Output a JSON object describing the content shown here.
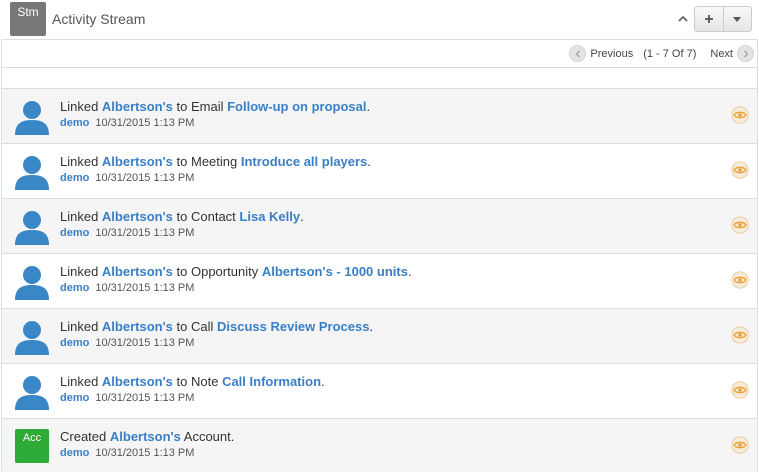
{
  "header": {
    "badge": "Stm",
    "title": "Activity Stream"
  },
  "pagination": {
    "previous": "Previous",
    "range": "(1 - 7 Of 7)",
    "next": "Next"
  },
  "colors": {
    "link": "#3a7fc6",
    "account_badge": "#2eaa37",
    "module_badge": "#777777",
    "eye_icon": "#e8a33d"
  },
  "rows": [
    {
      "prefix": "Linked ",
      "entity": "Albertson's",
      "middle": " to Email ",
      "target": "Follow-up on proposal",
      "suffix": ".",
      "user": "demo",
      "time": "10/31/2015 1:13 PM",
      "icon": "user-avatar-icon"
    },
    {
      "prefix": "Linked ",
      "entity": "Albertson's",
      "middle": " to Meeting ",
      "target": "Introduce all players",
      "suffix": ".",
      "user": "demo",
      "time": "10/31/2015 1:13 PM",
      "icon": "user-avatar-icon"
    },
    {
      "prefix": "Linked ",
      "entity": "Albertson's",
      "middle": " to Contact ",
      "target": "Lisa Kelly",
      "suffix": ".",
      "user": "demo",
      "time": "10/31/2015 1:13 PM",
      "icon": "user-avatar-icon"
    },
    {
      "prefix": "Linked ",
      "entity": "Albertson's",
      "middle": " to Opportunity ",
      "target": "Albertson's - 1000 units",
      "suffix": ".",
      "user": "demo",
      "time": "10/31/2015 1:13 PM",
      "icon": "user-avatar-icon"
    },
    {
      "prefix": "Linked ",
      "entity": "Albertson's",
      "middle": " to Call ",
      "target": "Discuss Review Process",
      "suffix": ".",
      "user": "demo",
      "time": "10/31/2015 1:13 PM",
      "icon": "user-avatar-icon"
    },
    {
      "prefix": "Linked ",
      "entity": "Albertson's",
      "middle": " to Note ",
      "target": "Call Information",
      "suffix": ".",
      "user": "demo",
      "time": "10/31/2015 1:13 PM",
      "icon": "user-avatar-icon"
    },
    {
      "prefix": "Created ",
      "entity": "Albertson's",
      "middle": " Account.",
      "target": "",
      "suffix": "",
      "user": "demo",
      "time": "10/31/2015 1:13 PM",
      "icon": "account-badge",
      "badge": "Acc"
    }
  ]
}
